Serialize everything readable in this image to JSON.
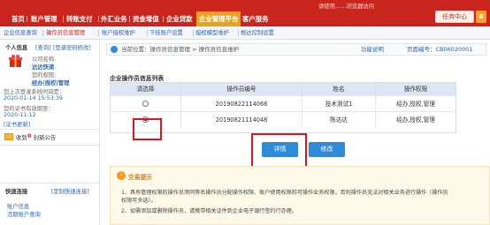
{
  "header": {
    "top_text": "请使用……浏览器访问",
    "nav_items": [
      "首页",
      "账户管理",
      "转账支付",
      "外汇业务",
      "资金增值",
      "企业贷款",
      "企业管理平台",
      "客户服务"
    ],
    "active_nav": "企业管理平台",
    "task_center": "任务中心",
    "task_count": "0"
  },
  "subnav": {
    "items": [
      "企业信息查询",
      "操作员信息管理",
      "账户授权维护",
      "下挂账户设置",
      "授权模型维护",
      "根达控制设置"
    ]
  },
  "sidebar": {
    "personal_title": "个人信息",
    "query_link": "[查询]",
    "modify_link": "[登录密码修改]",
    "company_label": "公司名称:",
    "company_name": "达达快递",
    "permission_label": "您的权限:",
    "permission_value": "经办|授权|管理",
    "last_login_label": "您上次登录系统时间是：",
    "last_login_time": "2020-01-14 15:53:39",
    "cert_label": "您的证书有效期至：",
    "cert_date": "2020-11-12",
    "cert_update": "[证书更新]",
    "notice_prefix": "收到",
    "notice_count": "0",
    "notice_suffix": "封新公告",
    "quick_title": "快速连接",
    "quick_custom": "[定制快速连接]",
    "quick_items": [
      "账户信息",
      "活期账户查询"
    ]
  },
  "main": {
    "breadcrumb": "当前位置：操作员信息管理 > 操作员信息维护",
    "func_desc": "功能说明",
    "page_code": "页面编号：CB06020001",
    "section_title": "企业操作员信息列表",
    "columns": [
      "请选择",
      "操作员编号",
      "姓名",
      "操作权限"
    ],
    "rows": [
      {
        "id": "20190822114068",
        "name": "技术测试1",
        "perm": "经办,授权,管理",
        "selected": false
      },
      {
        "id": "20190821114048",
        "name": "陈达达",
        "perm": "经办,授权,管理",
        "selected": true
      }
    ],
    "btn_detail": "详情",
    "btn_modify": "修改",
    "tip_title": "交易提示",
    "tip_1": "1、具有管理权限的操作员须同等名操作员分配操作权限、账户使用权限和可操作业务权限，否则操作员无法对相关业务进行操作（操作员",
    "tip_1b": "权限可多选）。",
    "tip_2": "2、如需添加或删除操作员，请携带相关证件到企业电子银行签约行办理。"
  },
  "colors": {
    "brand_red": "#c9251d",
    "active_orange": "#e8a31c",
    "button_blue": "#2e8bd8",
    "highlight": "#e0141b"
  }
}
